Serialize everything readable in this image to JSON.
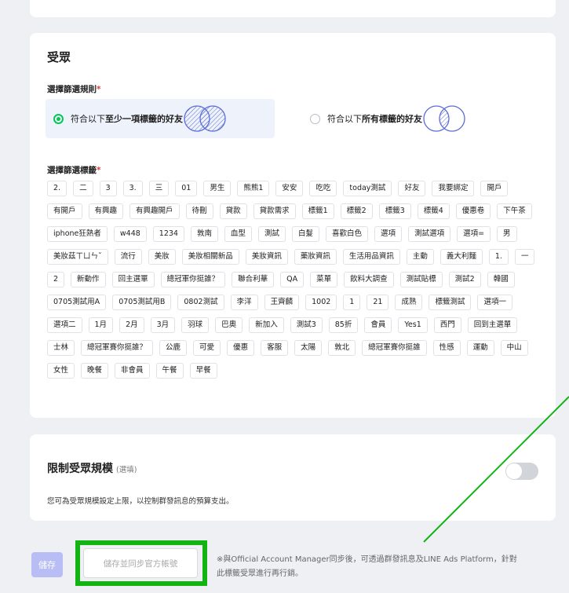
{
  "audience": {
    "title": "受眾",
    "rule_label": "選擇篩選規則",
    "required_mark": "*",
    "rule_any_prefix": "符合以下",
    "rule_any_bold": "至少一項標籤的好友",
    "rule_all_prefix": "符合以下",
    "rule_all_bold": "所有標籤的好友",
    "tags_label": "選擇篩選標籤",
    "tags": [
      "2.",
      "二",
      "3",
      "3.",
      "三",
      "01",
      "男生",
      "熊熊1",
      "安安",
      "吃吃",
      "today測試",
      "好友",
      "我要綁定",
      "開戶",
      "有開戶",
      "有興趣",
      "有興趣開戶",
      "待刪",
      "貸款",
      "貸款需求",
      "標籤1",
      "標籤2",
      "標籤3",
      "標籤4",
      "優惠卷",
      "下午茶",
      "iphone狂熱者",
      "w448",
      "1234",
      "敦南",
      "血型",
      "測試",
      "白髮",
      "喜歡白色",
      "選項",
      "測試選項",
      "選項=",
      "男",
      "美妝茲ㄒㄩㄣˇ",
      "流行",
      "美妝",
      "美妝相關新品",
      "美妝資訊",
      "藥妝資訊",
      "生活用品資訊",
      "主動",
      "義大利麵",
      "1.",
      "一",
      "2",
      "新動作",
      "回主選單",
      "總冠軍你挺誰？",
      "聯合利華",
      "QA",
      "菜單",
      "飲料大調查",
      "測試貼標",
      "測試2",
      "韓國",
      "0705測試用A",
      "0705測試用B",
      "0802測試",
      "李洋",
      "王齊麟",
      "1002",
      "1",
      "21",
      "成熟",
      "標籤測試",
      "選項一",
      "選項二",
      "1月",
      "2月",
      "3月",
      "羽球",
      "巴奧",
      "新加入",
      "測試3",
      "85折",
      "會員",
      "Yes1",
      "西門",
      "回到主選單",
      "士林",
      "總冠軍賽你挺誰？",
      "公鹿",
      "可愛",
      "優惠",
      "客服",
      "太陽",
      "敦北",
      "總冠軍賽你挺誰",
      "性感",
      "運動",
      "中山",
      "女性",
      "晚餐",
      "非會員",
      "午餐",
      "早餐"
    ]
  },
  "limit": {
    "title": "限制受眾規模",
    "optional": "(選填)",
    "description": "您可為受眾規模設定上限，以控制群發訊息的預算支出。"
  },
  "footer": {
    "save_label": "儲存",
    "sync_label": "儲存並同步官方帳號",
    "note_line1": "※與Official Account Manager同步後，可透過群發訊息及LINE Ads Platform，針對",
    "note_line2": "此標籤受眾進行再行銷。"
  },
  "colors": {
    "accent_green": "#06c755",
    "highlight_green": "#13b313",
    "save_button": "#b8bdf5",
    "venn_stroke": "#5a6bd8"
  }
}
